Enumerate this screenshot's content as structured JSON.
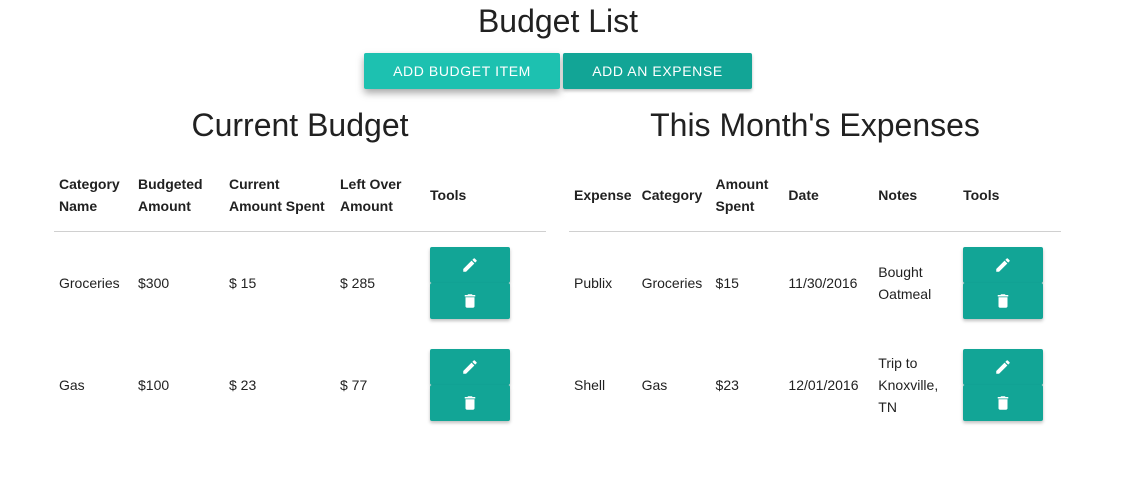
{
  "page": {
    "title": "Budget List"
  },
  "toolbar": {
    "add_budget_label": "ADD BUDGET ITEM",
    "add_expense_label": "ADD AN EXPENSE"
  },
  "budget": {
    "title": "Current Budget",
    "headers": [
      {
        "line1": "Category",
        "line2": "Name"
      },
      {
        "line1": "Budgeted",
        "line2": "Amount"
      },
      {
        "line1": "Current",
        "line2": "Amount Spent"
      },
      {
        "line1": "Left Over",
        "line2": "Amount"
      },
      {
        "line1": "Tools",
        "line2": ""
      }
    ],
    "rows": [
      {
        "category": "Groceries",
        "budgeted": "$300",
        "spent": "$ 15",
        "left": "$ 285"
      },
      {
        "category": "Gas",
        "budgeted": "$100",
        "spent": "$ 23",
        "left": "$ 77"
      }
    ]
  },
  "expenses": {
    "title": "This Month's Expenses",
    "headers": [
      {
        "line1": "Expense",
        "line2": ""
      },
      {
        "line1": "Category",
        "line2": ""
      },
      {
        "line1": "Amount",
        "line2": "Spent"
      },
      {
        "line1": "Date",
        "line2": ""
      },
      {
        "line1": "Notes",
        "line2": ""
      },
      {
        "line1": "Tools",
        "line2": ""
      }
    ],
    "rows": [
      {
        "expense": "Publix",
        "category": "Groceries",
        "amount": "$15",
        "date": "11/30/2016",
        "notes": [
          "Bought",
          "Oatmeal"
        ]
      },
      {
        "expense": "Shell",
        "category": "Gas",
        "amount": "$23",
        "date": "12/01/2016",
        "notes": [
          "Trip to",
          "Knoxville,",
          "TN"
        ]
      }
    ]
  },
  "icons": {
    "edit": "pencil-icon",
    "delete": "trash-icon"
  },
  "colors": {
    "primary": "#12a596",
    "primary_light": "#1dc1b0"
  }
}
